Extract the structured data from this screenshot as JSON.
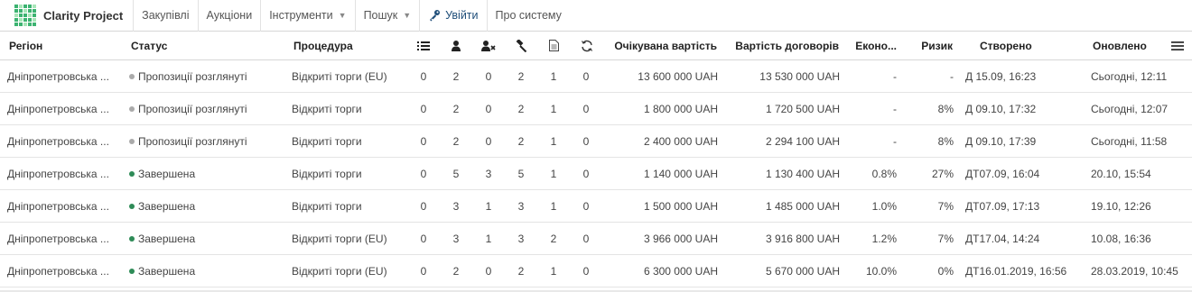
{
  "app": {
    "name": "Clarity Project"
  },
  "nav": {
    "items": [
      "Закупівлі",
      "Аукціони",
      "Інструменти",
      "Пошук",
      "Увійти",
      "Про систему"
    ],
    "caret": "▼"
  },
  "colors": {
    "status_reviewed": "#aaaaaa",
    "status_completed": "#2e8b57",
    "logo_green": "#3cb371",
    "logo_light": "#a8e6b8"
  },
  "table": {
    "headers": {
      "region": "Регіон",
      "status": "Статус",
      "procedure": "Процедура",
      "expected": "Очікувана вартість",
      "contracts": "Вартість договорів",
      "economy": "Еконо...",
      "risk": "Ризик",
      "created": "Створено",
      "updated": "Оновлено"
    },
    "header_icons": [
      "list-icon",
      "user-icon",
      "user-remove-icon",
      "gavel-icon",
      "document-icon",
      "refresh-icon",
      "menu-icon"
    ],
    "rows": [
      {
        "region": "Дніпропетровська ...",
        "status": "Пропозиції розглянуті",
        "status_type": "reviewed",
        "procedure": "Відкриті торги (EU)",
        "n1": "0",
        "n2": "2",
        "n3": "0",
        "n4": "2",
        "n5": "1",
        "n6": "0",
        "expected": "13 600 000 UAH",
        "contracts": "13 530 000 UAH",
        "economy": "-",
        "risk": "-",
        "created": "Д 15.09, 16:23",
        "updated": "Сьогодні, 12:11"
      },
      {
        "region": "Дніпропетровська ...",
        "status": "Пропозиції розглянуті",
        "status_type": "reviewed",
        "procedure": "Відкриті торги",
        "n1": "0",
        "n2": "2",
        "n3": "0",
        "n4": "2",
        "n5": "1",
        "n6": "0",
        "expected": "1 800 000 UAH",
        "contracts": "1 720 500 UAH",
        "economy": "-",
        "risk": "8%",
        "created": "Д 09.10, 17:32",
        "updated": "Сьогодні, 12:07"
      },
      {
        "region": "Дніпропетровська ...",
        "status": "Пропозиції розглянуті",
        "status_type": "reviewed",
        "procedure": "Відкриті торги",
        "n1": "0",
        "n2": "2",
        "n3": "0",
        "n4": "2",
        "n5": "1",
        "n6": "0",
        "expected": "2 400 000 UAH",
        "contracts": "2 294 100 UAH",
        "economy": "-",
        "risk": "8%",
        "created": "Д 09.10, 17:39",
        "updated": "Сьогодні, 11:58"
      },
      {
        "region": "Дніпропетровська ...",
        "status": "Завершена",
        "status_type": "completed",
        "procedure": "Відкриті торги",
        "n1": "0",
        "n2": "5",
        "n3": "3",
        "n4": "5",
        "n5": "1",
        "n6": "0",
        "expected": "1 140 000 UAH",
        "contracts": "1 130 400 UAH",
        "economy": "0.8%",
        "risk": "27%",
        "created": "ДТ07.09, 16:04",
        "updated": "20.10, 15:54"
      },
      {
        "region": "Дніпропетровська ...",
        "status": "Завершена",
        "status_type": "completed",
        "procedure": "Відкриті торги",
        "n1": "0",
        "n2": "3",
        "n3": "1",
        "n4": "3",
        "n5": "1",
        "n6": "0",
        "expected": "1 500 000 UAH",
        "contracts": "1 485 000 UAH",
        "economy": "1.0%",
        "risk": "7%",
        "created": "ДТ07.09, 17:13",
        "updated": "19.10, 12:26"
      },
      {
        "region": "Дніпропетровська ...",
        "status": "Завершена",
        "status_type": "completed",
        "procedure": "Відкриті торги (EU)",
        "n1": "0",
        "n2": "3",
        "n3": "1",
        "n4": "3",
        "n5": "2",
        "n6": "0",
        "expected": "3 966 000 UAH",
        "contracts": "3 916 800 UAH",
        "economy": "1.2%",
        "risk": "7%",
        "created": "ДТ17.04, 14:24",
        "updated": "10.08, 16:36"
      },
      {
        "region": "Дніпропетровська ...",
        "status": "Завершена",
        "status_type": "completed",
        "procedure": "Відкриті торги (EU)",
        "n1": "0",
        "n2": "2",
        "n3": "0",
        "n4": "2",
        "n5": "1",
        "n6": "0",
        "expected": "6 300 000 UAH",
        "contracts": "5 670 000 UAH",
        "economy": "10.0%",
        "risk": "0%",
        "created": "ДТ16.01.2019, 16:56",
        "updated": "28.03.2019, 10:45"
      }
    ]
  }
}
